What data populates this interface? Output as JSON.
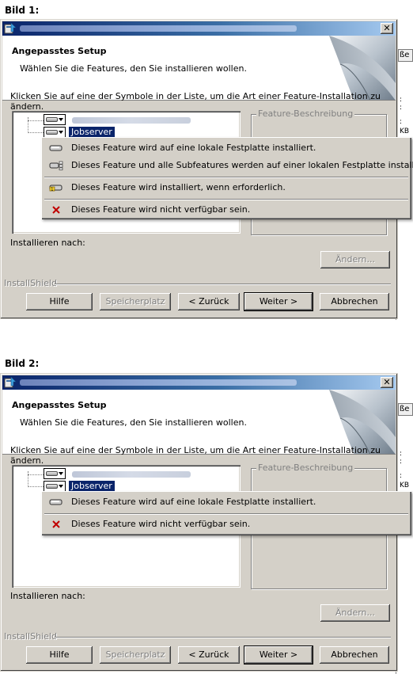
{
  "panels": [
    {
      "caption": "Bild 1:",
      "header_title": "Angepasstes Setup",
      "header_subtitle": "Wählen Sie die Features, den Sie installieren wollen.",
      "instruction": "Klicken Sie auf eine der Symbole in der Liste, um die Art einer Feature-Installation zu ändern.",
      "selected_feature": "Jobserver",
      "description_legend": "Feature-Beschreibung",
      "menu": [
        {
          "icon": "hard-drive-icon",
          "label": "Dieses Feature wird auf eine lokale Festplatte installiert."
        },
        {
          "icon": "hard-drive-with-subfeatures-icon",
          "label": "Dieses Feature und alle Subfeatures werden auf einer lokalen Festplatte installiert."
        },
        {
          "icon": "install-on-demand-icon",
          "label": "Dieses Feature wird installiert, wenn erforderlich."
        },
        {
          "icon": "unavailable-icon",
          "label": "Dieses Feature wird nicht verfügbar sein."
        }
      ],
      "install_to_label": "Installieren nach:",
      "change_button": "Ändern...",
      "installshield_label": "InstallShield",
      "buttons": {
        "help": "Hilfe",
        "space": "Speicherplatz",
        "back": "< Zurück",
        "next": "Weiter >",
        "cancel": "Abbrechen"
      },
      "background": {
        "button_text": "ße",
        "text_dots": ":",
        "text_kb": "KB"
      }
    },
    {
      "caption": "Bild 2:",
      "header_title": "Angepasstes Setup",
      "header_subtitle": "Wählen Sie die Features, den Sie installieren wollen.",
      "instruction": "Klicken Sie auf eine der Symbole in der Liste, um die Art einer Feature-Installation zu ändern.",
      "selected_feature": "Jobserver",
      "description_legend": "Feature-Beschreibung",
      "menu": [
        {
          "icon": "hard-drive-icon",
          "label": "Dieses Feature wird auf eine lokale Festplatte installiert."
        },
        {
          "icon": "unavailable-icon",
          "label": "Dieses Feature wird nicht verfügbar sein."
        }
      ],
      "install_to_label": "Installieren nach:",
      "change_button": "Ändern...",
      "installshield_label": "InstallShield",
      "buttons": {
        "help": "Hilfe",
        "space": "Speicherplatz",
        "back": "< Zurück",
        "next": "Weiter >",
        "cancel": "Abbrechen"
      },
      "background": {
        "button_text": "ße",
        "text_dots": ":",
        "text_kb": "KB"
      }
    }
  ],
  "colors": {
    "dialog_face": "#d4d0c8",
    "title_active_start": "#0a246a",
    "title_active_end": "#a6caf0",
    "selection": "#0a246a",
    "disabled_text": "#808080",
    "unavailable_x": "#c00000"
  }
}
